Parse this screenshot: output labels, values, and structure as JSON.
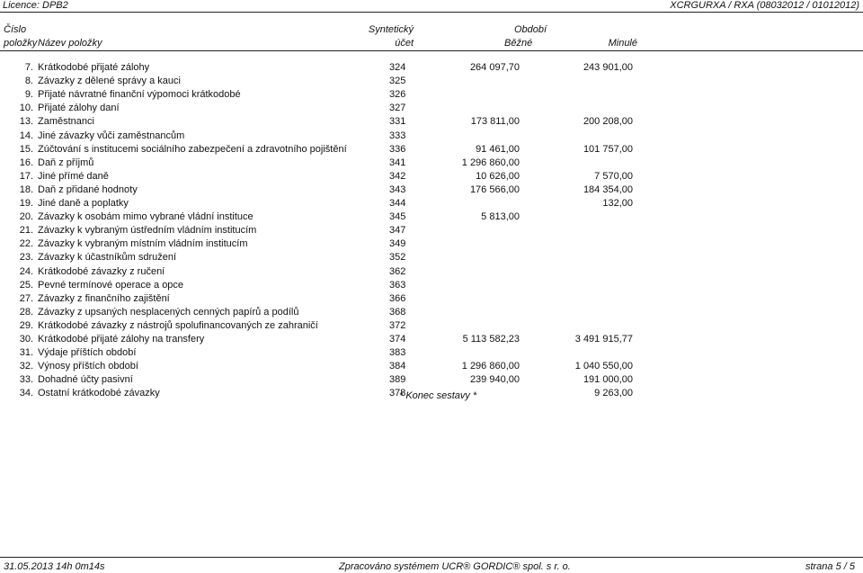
{
  "top_bar": {
    "license": "Licence: DPB2",
    "report_code": "XCRGURXA / RXA (08032012 / 01012012)"
  },
  "header": {
    "col_num_line1": "Číslo",
    "col_num_line2": "položky",
    "col_name": "Název položky",
    "col_syn_line1": "Syntetický",
    "col_syn_line2": "účet",
    "col_period": "Období",
    "col_current": "Běžné",
    "col_previous": "Minulé"
  },
  "rows": [
    {
      "num": "7.",
      "name": "Krátkodobé přijaté zálohy",
      "syn": "324",
      "current": "264 097,70",
      "previous": "243 901,00"
    },
    {
      "num": "8.",
      "name": "Závazky z dělené správy a kauci",
      "syn": "325",
      "current": "",
      "previous": ""
    },
    {
      "num": "9.",
      "name": "Přijaté návratné finanční výpomoci krátkodobé",
      "syn": "326",
      "current": "",
      "previous": ""
    },
    {
      "num": "10.",
      "name": "Přijaté zálohy daní",
      "syn": "327",
      "current": "",
      "previous": ""
    },
    {
      "num": "13.",
      "name": "Zaměstnanci",
      "syn": "331",
      "current": "173 811,00",
      "previous": "200 208,00"
    },
    {
      "num": "14.",
      "name": "Jiné závazky vůči zaměstnancům",
      "syn": "333",
      "current": "",
      "previous": ""
    },
    {
      "num": "15.",
      "name": "Zúčtování s institucemi sociálního zabezpečení a zdravotního pojištění",
      "syn": "336",
      "current": "91 461,00",
      "previous": "101 757,00"
    },
    {
      "num": "16.",
      "name": "Daň z příjmů",
      "syn": "341",
      "current": "1 296 860,00",
      "previous": ""
    },
    {
      "num": "17.",
      "name": "Jiné přímé daně",
      "syn": "342",
      "current": "10 626,00",
      "previous": "7 570,00"
    },
    {
      "num": "18.",
      "name": "Daň z přidané hodnoty",
      "syn": "343",
      "current": "176 566,00",
      "previous": "184 354,00"
    },
    {
      "num": "19.",
      "name": "Jiné daně a poplatky",
      "syn": "344",
      "current": "",
      "previous": "132,00"
    },
    {
      "num": "20.",
      "name": "Závazky k osobám mimo vybrané vládní instituce",
      "syn": "345",
      "current": "5 813,00",
      "previous": ""
    },
    {
      "num": "21.",
      "name": "Závazky k vybraným ústředním vládním institucím",
      "syn": "347",
      "current": "",
      "previous": ""
    },
    {
      "num": "22.",
      "name": "Závazky k vybraným místním vládním institucím",
      "syn": "349",
      "current": "",
      "previous": ""
    },
    {
      "num": "23.",
      "name": "Závazky k účastníkům sdružení",
      "syn": "352",
      "current": "",
      "previous": ""
    },
    {
      "num": "24.",
      "name": "Krátkodobé závazky z ručení",
      "syn": "362",
      "current": "",
      "previous": ""
    },
    {
      "num": "25.",
      "name": "Pevné termínové operace a opce",
      "syn": "363",
      "current": "",
      "previous": ""
    },
    {
      "num": "27.",
      "name": "Závazky z finančního zajištění",
      "syn": "366",
      "current": "",
      "previous": ""
    },
    {
      "num": "28.",
      "name": "Závazky z upsaných nesplacených cenných papírů a podílů",
      "syn": "368",
      "current": "",
      "previous": ""
    },
    {
      "num": "29.",
      "name": "Krátkodobé závazky z nástrojů spolufinancovaných ze zahraničí",
      "syn": "372",
      "current": "",
      "previous": ""
    },
    {
      "num": "30.",
      "name": "Krátkodobé přijaté zálohy na transfery",
      "syn": "374",
      "current": "5 113 582,23",
      "previous": "3 491 915,77"
    },
    {
      "num": "31.",
      "name": "Výdaje příštích období",
      "syn": "383",
      "current": "",
      "previous": ""
    },
    {
      "num": "32.",
      "name": "Výnosy příštích období",
      "syn": "384",
      "current": "1 296 860,00",
      "previous": "1 040 550,00"
    },
    {
      "num": "33.",
      "name": "Dohadné účty pasivní",
      "syn": "389",
      "current": "239 940,00",
      "previous": "191 000,00"
    },
    {
      "num": "34.",
      "name": "Ostatní krátkodobé závazky",
      "syn": "378",
      "current": "",
      "previous": "9 263,00"
    }
  ],
  "end_note": "* Konec sestavy *",
  "footer": {
    "timestamp": "31.05.2013 14h 0m14s",
    "processed_by": "Zpracováno systémem UCR® GORDIC® spol. s r. o.",
    "page": "strana 5 / 5"
  }
}
